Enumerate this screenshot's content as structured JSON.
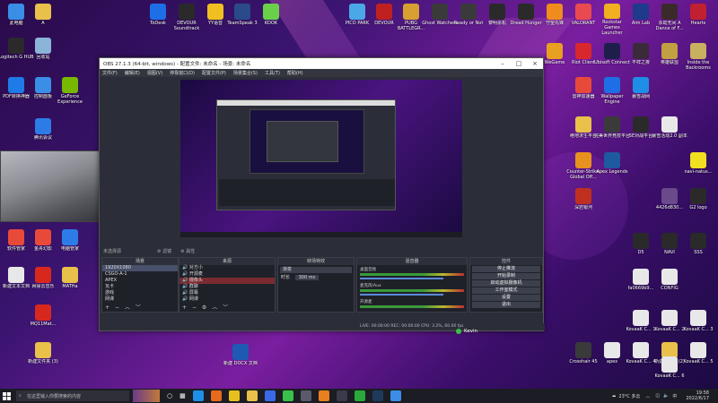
{
  "desktop": {
    "icons_left": [
      {
        "label": "此电脑",
        "icon": "computer-icon",
        "color": "#3a8ee6"
      },
      {
        "label": "A",
        "icon": "folder-icon",
        "color": "#e8c04a"
      },
      {
        "label": "Logitech G HUB",
        "icon": "logitech-icon",
        "color": "#2a2a2a"
      },
      {
        "label": "回收站",
        "icon": "recycle-bin-icon",
        "color": "#8ab4d8"
      },
      {
        "label": "PDF转换神器",
        "icon": "pdf-icon",
        "color": "#1e7ae6"
      },
      {
        "label": "控制面板",
        "icon": "control-panel-icon",
        "color": "#3a8ee6"
      },
      {
        "label": "GeForce Experience",
        "icon": "nvidia-icon",
        "color": "#76b900"
      },
      {
        "label": "腾讯会议",
        "icon": "meeting-icon",
        "color": "#2d7be6"
      },
      {
        "label": "软件管家",
        "icon": "app-manager-icon",
        "color": "#e84a3a"
      },
      {
        "label": "金舟幻影",
        "icon": "jinzhou-icon",
        "color": "#e84a3a"
      },
      {
        "label": "电脑管家",
        "icon": "pc-manager-icon",
        "color": "#2d7be6"
      },
      {
        "label": "新建文本文档",
        "icon": "text-file-icon",
        "color": "#e8e8e8"
      },
      {
        "label": "网易云音乐",
        "icon": "netease-music-icon",
        "color": "#d8281e"
      },
      {
        "label": "MATHa",
        "icon": "folder-icon",
        "color": "#e8c04a"
      },
      {
        "label": "MQ11Mat...",
        "icon": "pdf-icon",
        "color": "#d8281e"
      },
      {
        "label": "新建文件夹 (3)",
        "icon": "folder-icon",
        "color": "#e8c04a"
      }
    ],
    "icons_top": [
      {
        "label": "ToDesk",
        "icon": "todesk-icon",
        "color": "#1e6ee6"
      },
      {
        "label": "DEVOUR Soundtrack",
        "icon": "music-icon",
        "color": "#2a2a2a"
      },
      {
        "label": "YY语音",
        "icon": "yy-icon",
        "color": "#f0c020"
      },
      {
        "label": "TeamSpeak 3",
        "icon": "teamspeak-icon",
        "color": "#2a4a8a"
      },
      {
        "label": "KOOK",
        "icon": "kook-icon",
        "color": "#6ad04a"
      },
      {
        "label": "PICO PARK",
        "icon": "pico-park-icon",
        "color": "#4aa8e6"
      },
      {
        "label": "DEVOUR",
        "icon": "devour-icon",
        "color": "#c02020"
      },
      {
        "label": "PUBG BATTLEGR...",
        "icon": "pubg-icon",
        "color": "#d8a030"
      },
      {
        "label": "Ghost Watchers",
        "icon": "ghost-icon",
        "color": "#3a3a3a"
      },
      {
        "label": "Ready or Not",
        "icon": "ready-or-not-icon",
        "color": "#3a3a3a"
      },
      {
        "label": "黎明杀机",
        "icon": "dbd-icon",
        "color": "#2a2a2a"
      },
      {
        "label": "Dread Hunger",
        "icon": "dread-hunger-icon",
        "color": "#2a2a2a"
      },
      {
        "label": "守望先锋",
        "icon": "overwatch-icon",
        "color": "#f08c1e"
      },
      {
        "label": "VALORANT",
        "icon": "valorant-icon",
        "color": "#e84a50"
      },
      {
        "label": "Rockstar Games Launcher",
        "icon": "rockstar-icon",
        "color": "#f0b020"
      },
      {
        "label": "Aim Lab",
        "icon": "aimlab-icon",
        "color": "#1e3a8a"
      },
      {
        "label": "永劫无间 A Dance of F...",
        "icon": "naraka-icon",
        "color": "#3a2a2a"
      },
      {
        "label": "Hearts",
        "icon": "hearts-icon",
        "color": "#c02030"
      }
    ],
    "icons_right": [
      {
        "label": "WeGame",
        "icon": "wegame-icon",
        "color": "#e8a020"
      },
      {
        "label": "Riot Client",
        "icon": "riot-icon",
        "color": "#d8282e"
      },
      {
        "label": "Ubisoft Connect",
        "icon": "ubisoft-icon",
        "color": "#1e1e4a"
      },
      {
        "label": "不祥之夜",
        "icon": "game-icon",
        "color": "#3a2a3a"
      },
      {
        "label": "英雄联盟",
        "icon": "lol-icon",
        "color": "#c0a040"
      },
      {
        "label": "Inside the Backrooms",
        "icon": "backrooms-icon",
        "color": "#c8b060"
      },
      {
        "label": "雷神加速器",
        "icon": "leishen-icon",
        "color": "#e84a3a"
      },
      {
        "label": "Wallpaper Engine",
        "icon": "wallpaper-engine-icon",
        "color": "#1e6ee6"
      },
      {
        "label": "暴雪战网",
        "icon": "battlenet-icon",
        "color": "#1e8ee6"
      },
      {
        "label": "绝地求生平台",
        "icon": "platform-icon",
        "color": "#e8c04a"
      },
      {
        "label": "完美世界竞技平台",
        "icon": "perfect-world-icon",
        "color": "#3a3a3a"
      },
      {
        "label": "5E对战平台",
        "icon": "5e-icon",
        "color": "#2a2a2a"
      },
      {
        "label": "暴雪活动2.0 副本",
        "icon": "text-file-icon",
        "color": "#e8e8e8"
      },
      {
        "label": "Counter-Strike: Global Off...",
        "icon": "csgo-icon",
        "color": "#e89020"
      },
      {
        "label": "Apex Legends",
        "icon": "apex-icon",
        "color": "#1e5aa0"
      },
      {
        "label": "navi-natus...",
        "icon": "navi-icon",
        "color": "#f0e020"
      },
      {
        "label": "深岩银河",
        "icon": "drg-icon",
        "color": "#c03020"
      },
      {
        "label": "4426d830...",
        "icon": "image-icon",
        "color": "#6a4a8a"
      },
      {
        "label": "G2 logo",
        "icon": "image-icon",
        "color": "#2a2a2a"
      },
      {
        "label": "D5",
        "icon": "image-icon",
        "color": "#2a2a2a"
      },
      {
        "label": "NAVI",
        "icon": "image-icon",
        "color": "#2a2a2a"
      },
      {
        "label": "SSS",
        "icon": "image-icon",
        "color": "#2a2a2a"
      },
      {
        "label": "fa0669b9...",
        "icon": "text-file-icon",
        "color": "#e8e8e8"
      },
      {
        "label": "CONFIG",
        "icon": "text-file-icon",
        "color": "#e8e8e8"
      },
      {
        "label": "KovaaK C... 1",
        "icon": "text-file-icon",
        "color": "#e8e8e8"
      },
      {
        "label": "KovaaK C... 2",
        "icon": "text-file-icon",
        "color": "#e8e8e8"
      },
      {
        "label": "KovaaK C... 3",
        "icon": "text-file-icon",
        "color": "#e8e8e8"
      },
      {
        "label": "Crosshair 45",
        "icon": "image-icon",
        "color": "#3a3a3a"
      },
      {
        "label": "apex",
        "icon": "text-file-icon",
        "color": "#e8e8e8"
      },
      {
        "label": "新建文件夹 (2)",
        "icon": "folder-icon",
        "color": "#e8c04a"
      },
      {
        "label": "KovaaK C... 5",
        "icon": "text-file-icon",
        "color": "#e8e8e8"
      },
      {
        "label": "KovaaK C... 6",
        "icon": "text-file-icon",
        "color": "#e8e8e8"
      },
      {
        "label": "KovaaK C... 4",
        "icon": "text-file-icon",
        "color": "#e8e8e8"
      }
    ],
    "icons_bottom_center": [
      {
        "label": "新建 DOCX 文档",
        "icon": "docx-icon",
        "color": "#1e5ab4"
      }
    ]
  },
  "obs": {
    "title": "OBS 27.1.3 (64-bit, windows) - 配置文件: 未命名 - 场景: 未命名",
    "menu": [
      "文件(F)",
      "编辑(E)",
      "视图(V)",
      "停靠窗口(D)",
      "配置文件(P)",
      "场景集合(S)",
      "工具(T)",
      "帮助(H)"
    ],
    "scene_status": "未选择源",
    "filters_label": "滤镜",
    "properties_label": "属性",
    "docks": {
      "scenes": {
        "title": "场景",
        "items": [
          "1920X1080",
          "CSGO-A-1",
          "APEX",
          "瓦卡",
          "游戏",
          "网课"
        ]
      },
      "sources": {
        "title": "来源",
        "items": [
          "对方小",
          "开源麦",
          "摄像头",
          "群聊",
          "屏幕",
          "网课"
        ]
      },
      "transitions": {
        "title": "转场特效",
        "type": "渐变",
        "duration_label": "时长",
        "duration": "300 ms"
      },
      "mixer": {
        "title": "混音器",
        "tracks": [
          "桌面音频",
          "麦克风/Aux",
          "开源麦"
        ]
      },
      "controls": {
        "title": "控件",
        "buttons": [
          "停止推流",
          "开始录制",
          "启动虚拟摄像机",
          "工作室模式",
          "设置",
          "退出"
        ]
      }
    },
    "status_bar": "LIVE: 00:00:00   REC: 00:00:00   CPU: 3.2%, 60.00 fps",
    "user_name": "Kevin"
  },
  "taskbar": {
    "search_placeholder": "在这里输入你要搜索的内容",
    "weather": "23°C 多云",
    "language": "中",
    "time": "19:58",
    "date": "2022/6/17"
  }
}
